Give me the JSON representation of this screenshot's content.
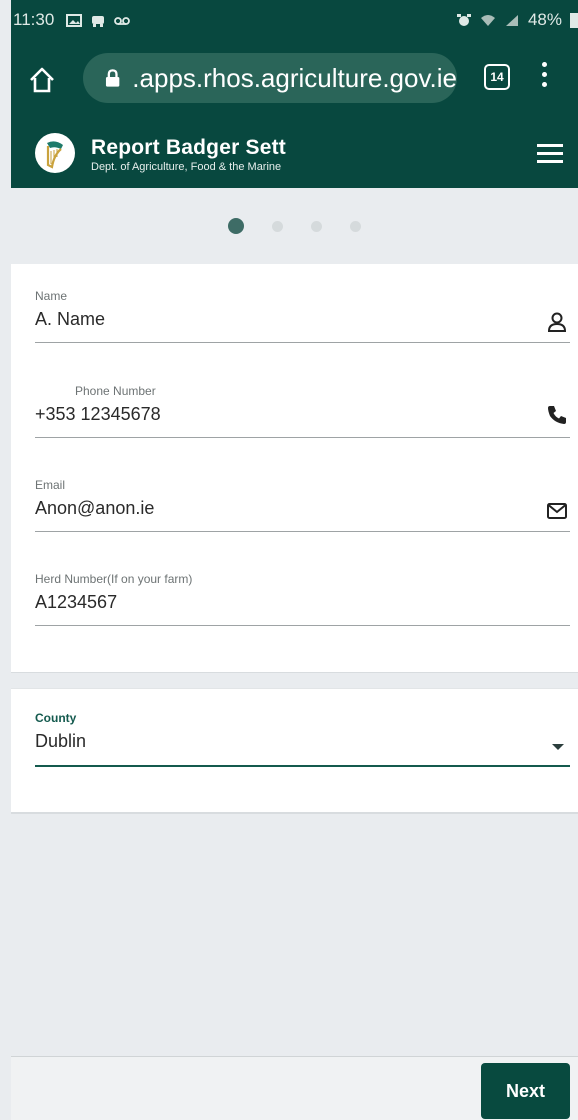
{
  "status": {
    "time": "11:30",
    "battery": "48%"
  },
  "browser": {
    "url": ".apps.rhos.agriculture.gov.ie",
    "tab_count": "14"
  },
  "app": {
    "title": "Report Badger Sett",
    "subtitle": "Dept. of Agriculture, Food & the Marine"
  },
  "progress": {
    "total_steps": 4,
    "current_step": 1
  },
  "form": {
    "name": {
      "label": "Name",
      "value": "A. Name"
    },
    "phone": {
      "label": "Phone Number",
      "value": "+353 12345678"
    },
    "email": {
      "label": "Email",
      "value": "Anon@anon.ie"
    },
    "herd": {
      "label": "Herd Number(If on your farm)",
      "value": "A1234567"
    },
    "county": {
      "label": "County",
      "value": "Dublin"
    }
  },
  "actions": {
    "next_label": "Next"
  },
  "colors": {
    "brand": "#08483f",
    "accent": "#145a4e",
    "background": "#e9ecef"
  }
}
